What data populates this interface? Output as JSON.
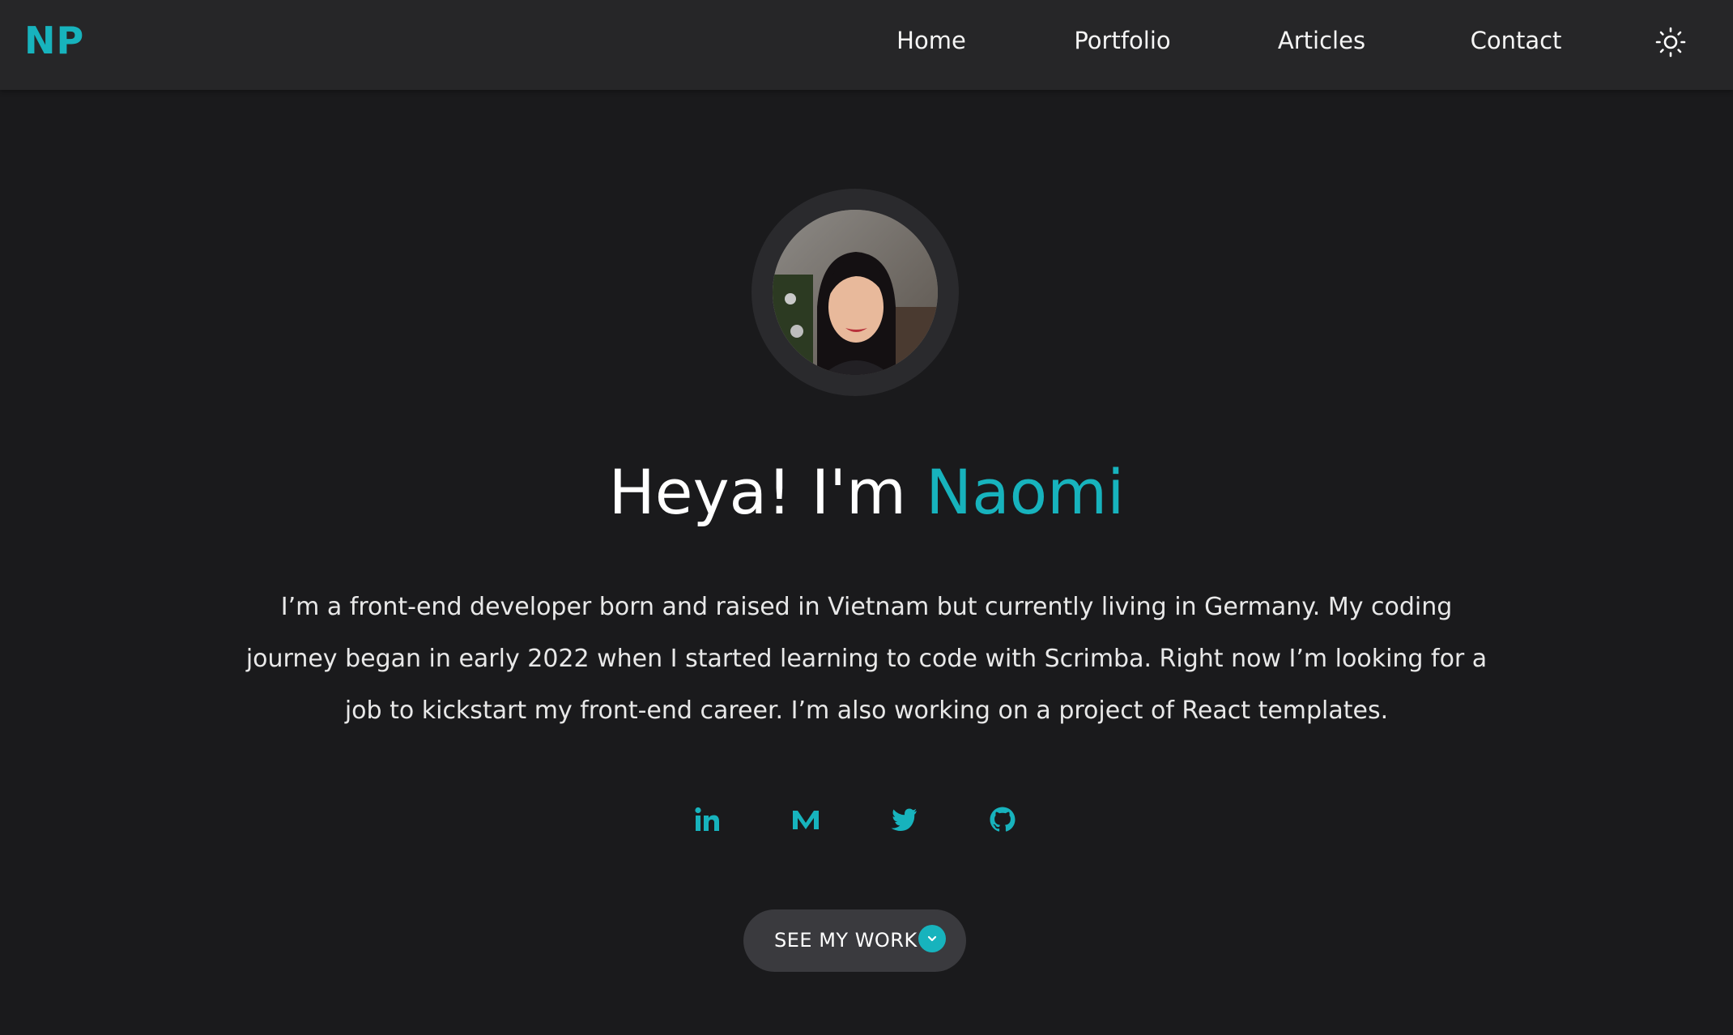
{
  "nav": {
    "logo": "NP",
    "links": [
      {
        "label": "Home"
      },
      {
        "label": "Portfolio"
      },
      {
        "label": "Articles"
      },
      {
        "label": "Contact"
      }
    ],
    "theme_toggle_icon": "sun-icon"
  },
  "hero": {
    "avatar_alt": "Profile photo",
    "greeting": "Heya! I'm",
    "name": "Naomi",
    "bio": "I’m a front-end developer born and raised in Vietnam but currently living in Germany. My coding journey began in early 2022 when I started learning to code with Scrimba. Right now I’m looking for a job to kickstart my front-end career. I’m also working on a project of React templates."
  },
  "socials": [
    {
      "icon": "linkedin-icon"
    },
    {
      "icon": "medium-icon"
    },
    {
      "icon": "twitter-icon"
    },
    {
      "icon": "github-icon"
    }
  ],
  "cta": {
    "label": "SEE MY WORK",
    "icon": "chevron-down-icon"
  },
  "colors": {
    "accent": "#17b3bd",
    "background": "#1a1a1c",
    "navbar": "#262628",
    "button": "#3a3a3e"
  }
}
